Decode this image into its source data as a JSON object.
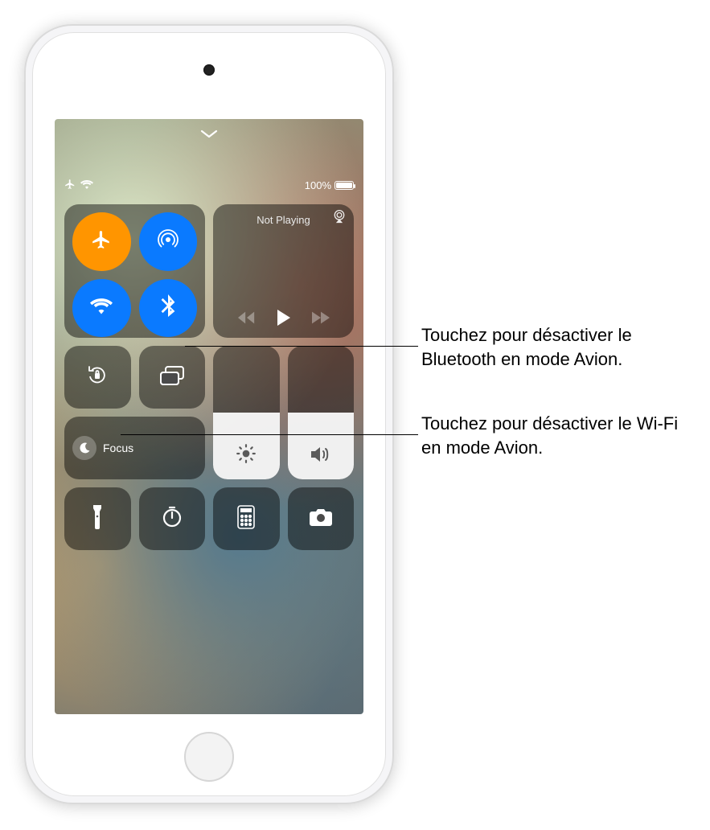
{
  "status": {
    "battery_text": "100%"
  },
  "connectivity": {
    "airplane": {
      "name": "airplane-mode",
      "on": true
    },
    "airdrop": {
      "name": "airdrop",
      "on": true
    },
    "wifi": {
      "name": "wifi",
      "on": true
    },
    "bluetooth": {
      "name": "bluetooth",
      "on": true
    }
  },
  "now_playing": {
    "title": "Not Playing"
  },
  "focus": {
    "label": "Focus"
  },
  "sliders": {
    "brightness_percent": 50,
    "volume_percent": 50
  },
  "callouts": {
    "bluetooth": "Touchez pour désactiver le Bluetooth en mode Avion.",
    "wifi": "Touchez pour désactiver le Wi-Fi en mode Avion."
  },
  "icons": {
    "chevron_down": "chevron-down-icon",
    "airplane_status": "airplane-status-icon",
    "wifi_status": "wifi-status-icon",
    "airplay": "airplay-icon",
    "rewind": "rewind-icon",
    "play": "play-icon",
    "forward": "forward-icon",
    "rotation_lock": "rotation-lock-icon",
    "screen_mirroring": "screen-mirroring-icon",
    "moon": "moon-icon",
    "brightness": "brightness-icon",
    "volume": "volume-icon",
    "flashlight": "flashlight-icon",
    "timer": "timer-icon",
    "calculator": "calculator-icon",
    "camera": "camera-icon"
  }
}
